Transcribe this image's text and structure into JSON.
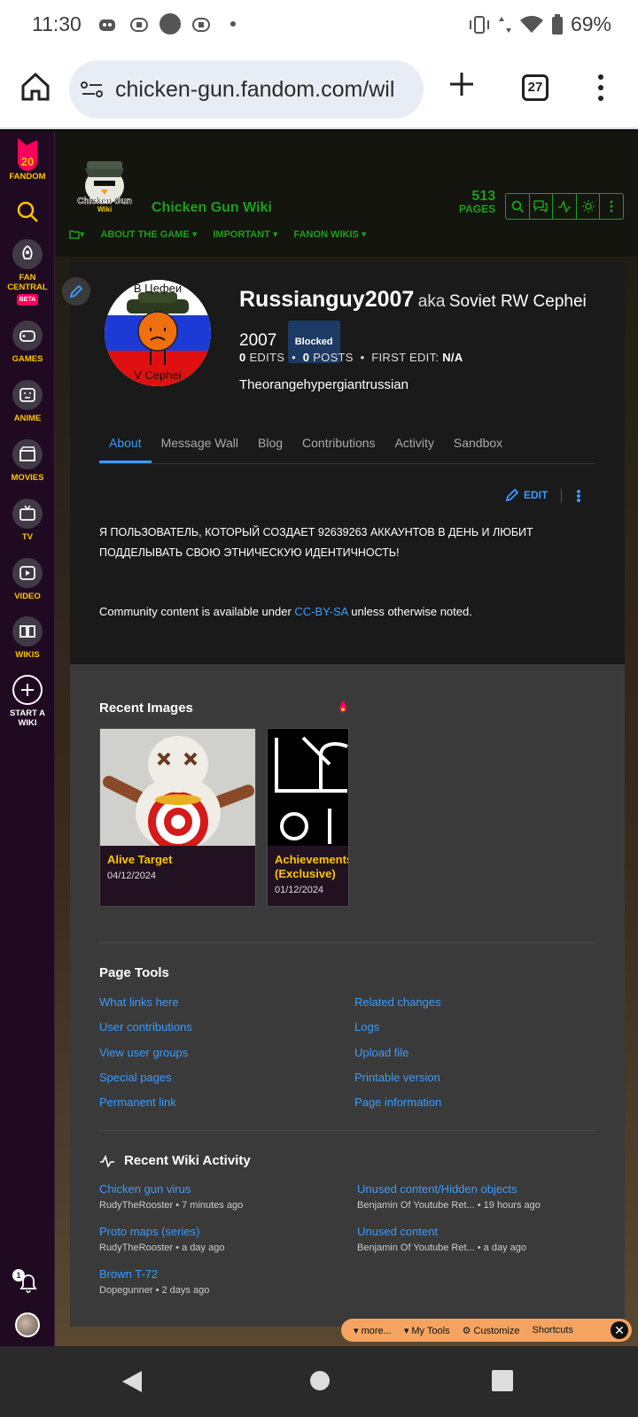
{
  "status_bar": {
    "time": "11:30",
    "battery": "69%"
  },
  "browser": {
    "url": "chicken-gun.fandom.com/wil",
    "tab_count": "27"
  },
  "sidebar": {
    "items": [
      {
        "label": "FANDOM",
        "badge": "20"
      },
      {
        "label": "FAN CENTRAL",
        "beta": "BETA"
      },
      {
        "label": "GAMES"
      },
      {
        "label": "ANIME"
      },
      {
        "label": "MOVIES"
      },
      {
        "label": "TV"
      },
      {
        "label": "VIDEO"
      },
      {
        "label": "WIKIS"
      },
      {
        "label": "START A WIKI"
      }
    ],
    "notification_count": "1"
  },
  "wiki": {
    "name": "Chicken Gun Wiki",
    "pages_count": "513",
    "pages_label": "PAGES",
    "nav": [
      "ABOUT THE GAME",
      "IMPORTANT",
      "FANON WIKIS"
    ]
  },
  "profile": {
    "username": "Russianguy2007",
    "aka": "aka",
    "real_name": "Soviet RW Cephei 2007",
    "blocked": "Blocked",
    "edits": "0",
    "edits_label": "EDITS",
    "posts": "0",
    "posts_label": "POSTS",
    "first_edit_label": "FIRST EDIT:",
    "first_edit": "N/A",
    "bio": "Theorangehypergiantrussian",
    "avatar_top_text": "В Цефеи",
    "avatar_bottom_text": "V Cephei"
  },
  "tabs": [
    "About",
    "Message Wall",
    "Blog",
    "Contributions",
    "Activity",
    "Sandbox"
  ],
  "about": {
    "edit_label": "EDIT",
    "text": "Я ПОЛЬЗОВАТЕЛЬ, КОТОРЫЙ СОЗДАЕТ 92639263 АККАУНТОВ В ДЕНЬ И ЛЮБИТ ПОДДЕЛЫВАТЬ СВОЮ ЭТНИЧЕСКУЮ ИДЕНТИЧНОСТЬ!",
    "license_prefix": "Community content is available under",
    "license_link": "CC-BY-SA",
    "license_suffix": "unless otherwise noted."
  },
  "recent_images": {
    "title": "Recent Images",
    "items": [
      {
        "title": "Alive Target",
        "date": "04/12/2024"
      },
      {
        "title": "Achievements (Exclusive)",
        "date": "01/12/2024"
      }
    ]
  },
  "page_tools": {
    "title": "Page Tools",
    "left": [
      "What links here",
      "User contributions",
      "View user groups",
      "Special pages",
      "Permanent link"
    ],
    "right": [
      "Related changes",
      "Logs",
      "Upload file",
      "Printable version",
      "Page information"
    ]
  },
  "recent_activity": {
    "title": "Recent Wiki Activity",
    "items": [
      {
        "title": "Chicken gun virus",
        "meta": "RudyTheRooster • 7 minutes ago"
      },
      {
        "title": "Unused content/Hidden objects",
        "meta": "Benjamin Of Youtube Ret... • 19 hours ago"
      },
      {
        "title": "Proto maps (series)",
        "meta": "RudyTheRooster • a day ago"
      },
      {
        "title": "Unused content",
        "meta": "Benjamin Of Youtube Ret... • a day ago"
      },
      {
        "title": "Brown T-72",
        "meta": "Dopegunner • 2 days ago"
      }
    ]
  },
  "toolbar": {
    "more": "more...",
    "my_tools": "My Tools",
    "customize": "Customize",
    "shortcuts": "Shortcuts"
  }
}
